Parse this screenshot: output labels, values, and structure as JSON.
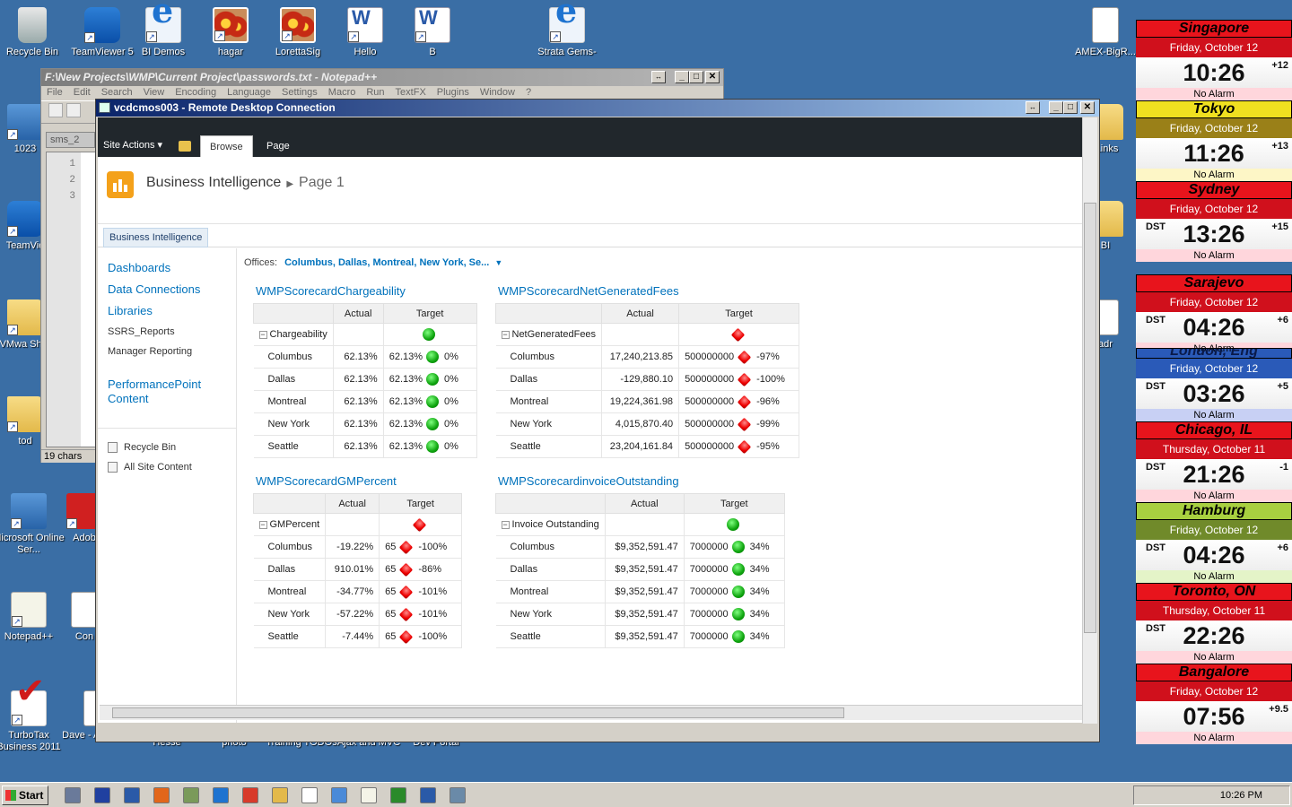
{
  "desktop_icons": [
    {
      "label": "Recycle Bin",
      "icon": "recycle-bin-icon"
    },
    {
      "label": "TeamViewer 5",
      "icon": "teamviewer-icon"
    },
    {
      "label": "BI Demos",
      "icon": "ie-icon"
    },
    {
      "label": "hagar",
      "icon": "flower-image-icon"
    },
    {
      "label": "LorettaSig",
      "icon": "flower-image-icon"
    },
    {
      "label": "Hello",
      "icon": "word-doc-icon"
    },
    {
      "label": "B",
      "icon": "word-doc-icon"
    },
    {
      "label": "Strata Gems-",
      "icon": "ie-icon"
    },
    {
      "label": "AMEX-BigR...",
      "icon": "document-icon"
    },
    {
      "label": "1023",
      "icon": "app-icon"
    },
    {
      "label": "TeamVie",
      "icon": "teamviewer-icon"
    },
    {
      "label": "VMwa Shar",
      "icon": "folder-icon"
    },
    {
      "label": "tod",
      "icon": "folder-icon"
    },
    {
      "label": "Microsoft Online Ser...",
      "icon": "ms-online-icon"
    },
    {
      "label": "Adob",
      "icon": "adobe-icon"
    },
    {
      "label": "Notepad++",
      "icon": "notepadpp-icon"
    },
    {
      "label": "Con",
      "icon": "document-icon"
    },
    {
      "label": "TurboTax Business 2011",
      "icon": "turbotax-icon"
    },
    {
      "label": "Dave - Australia",
      "icon": "document-icon"
    },
    {
      "label": ".Links",
      "icon": "folder-icon"
    },
    {
      "label": "BI",
      "icon": "folder-icon"
    },
    {
      "label": "adr",
      "icon": "document-icon"
    }
  ],
  "desktop_bottom_partial": [
    "Hesse",
    "photo",
    "Training TODOs",
    "Ajax and MVC",
    "Dev Portal"
  ],
  "notepad": {
    "title": "F:\\New Projects\\WMP\\Current Project\\passwords.txt - Notepad++",
    "menu": [
      "File",
      "Edit",
      "Search",
      "View",
      "Encoding",
      "Language",
      "Settings",
      "Macro",
      "Run",
      "TextFX",
      "Plugins",
      "Window",
      "?"
    ],
    "tab": "sms_2",
    "lines": [
      "1",
      "2",
      "3"
    ],
    "status": "19 chars",
    "status2": "2",
    "close_x": "X"
  },
  "rdp": {
    "title": "vcdcmos003 - Remote Desktop Connection"
  },
  "sharepoint": {
    "site_actions": "Site Actions",
    "tabs": [
      "Browse",
      "Page"
    ],
    "site_title": "Business Intelligence",
    "page_title": "Page 1",
    "top_nav": "Business Intelligence",
    "quick_launch": [
      "Dashboards",
      "Data Connections",
      "Libraries"
    ],
    "quick_launch_small": [
      "SSRS_Reports",
      "Manager Reporting"
    ],
    "performancepoint": "PerformancePoint Content",
    "recycle_bin": "Recycle Bin",
    "all_site_content": "All Site Content",
    "filter_label": "Offices:",
    "filter_value": "Columbus, Dallas, Montreal, New York, Se...",
    "scorecards": [
      {
        "title": "WMPScorecardChargeability",
        "headers": [
          "Actual",
          "Target"
        ],
        "group": {
          "label": "Chargeability",
          "indicator": "green-circle"
        },
        "rows": [
          {
            "name": "Columbus",
            "actual": "62.13%",
            "target": "62.13%",
            "indicator": "green-circle",
            "variance": "0%"
          },
          {
            "name": "Dallas",
            "actual": "62.13%",
            "target": "62.13%",
            "indicator": "green-circle",
            "variance": "0%"
          },
          {
            "name": "Montreal",
            "actual": "62.13%",
            "target": "62.13%",
            "indicator": "green-circle",
            "variance": "0%"
          },
          {
            "name": "New York",
            "actual": "62.13%",
            "target": "62.13%",
            "indicator": "green-circle",
            "variance": "0%"
          },
          {
            "name": "Seattle",
            "actual": "62.13%",
            "target": "62.13%",
            "indicator": "green-circle",
            "variance": "0%"
          }
        ]
      },
      {
        "title": "WMPScorecardNetGeneratedFees",
        "headers": [
          "Actual",
          "Target"
        ],
        "group": {
          "label": "NetGeneratedFees",
          "indicator": "red-diamond"
        },
        "rows": [
          {
            "name": "Columbus",
            "actual": "17,240,213.85",
            "target": "500000000",
            "indicator": "red-diamond",
            "variance": "-97%"
          },
          {
            "name": "Dallas",
            "actual": "-129,880.10",
            "target": "500000000",
            "indicator": "red-diamond",
            "variance": "-100%"
          },
          {
            "name": "Montreal",
            "actual": "19,224,361.98",
            "target": "500000000",
            "indicator": "red-diamond",
            "variance": "-96%"
          },
          {
            "name": "New York",
            "actual": "4,015,870.40",
            "target": "500000000",
            "indicator": "red-diamond",
            "variance": "-99%"
          },
          {
            "name": "Seattle",
            "actual": "23,204,161.84",
            "target": "500000000",
            "indicator": "red-diamond",
            "variance": "-95%"
          }
        ]
      },
      {
        "title": "WMPScorecardGMPercent",
        "headers": [
          "Actual",
          "Target"
        ],
        "group": {
          "label": "GMPercent",
          "indicator": "red-diamond"
        },
        "rows": [
          {
            "name": "Columbus",
            "actual": "-19.22%",
            "target": "65",
            "indicator": "red-diamond",
            "variance": "-100%"
          },
          {
            "name": "Dallas",
            "actual": "910.01%",
            "target": "65",
            "indicator": "red-diamond",
            "variance": "-86%"
          },
          {
            "name": "Montreal",
            "actual": "-34.77%",
            "target": "65",
            "indicator": "red-diamond",
            "variance": "-101%"
          },
          {
            "name": "New York",
            "actual": "-57.22%",
            "target": "65",
            "indicator": "red-diamond",
            "variance": "-101%"
          },
          {
            "name": "Seattle",
            "actual": "-7.44%",
            "target": "65",
            "indicator": "red-diamond",
            "variance": "-100%"
          }
        ]
      },
      {
        "title": "WMPScorecardinvoiceOutstanding",
        "headers": [
          "Actual",
          "Target"
        ],
        "group": {
          "label": "Invoice Outstanding",
          "indicator": "green-circle"
        },
        "rows": [
          {
            "name": "Columbus",
            "actual": "$9,352,591.47",
            "target": "7000000",
            "indicator": "green-circle",
            "variance": "34%"
          },
          {
            "name": "Dallas",
            "actual": "$9,352,591.47",
            "target": "7000000",
            "indicator": "green-circle",
            "variance": "34%"
          },
          {
            "name": "Montreal",
            "actual": "$9,352,591.47",
            "target": "7000000",
            "indicator": "green-circle",
            "variance": "34%"
          },
          {
            "name": "New York",
            "actual": "$9,352,591.47",
            "target": "7000000",
            "indicator": "green-circle",
            "variance": "34%"
          },
          {
            "name": "Seattle",
            "actual": "$9,352,591.47",
            "target": "7000000",
            "indicator": "green-circle",
            "variance": "34%"
          }
        ]
      }
    ]
  },
  "clocks": [
    {
      "city": "Singapore",
      "date": "Friday, October 12",
      "time": "10:26",
      "dst": "",
      "offset": "+12",
      "alarm": "No Alarm",
      "city_bg": "#e8141c",
      "date_bg": "#d0101c",
      "alarm_bg": "#ffd6dc"
    },
    {
      "city": "Tokyo",
      "date": "Friday, October 12",
      "time": "11:26",
      "dst": "",
      "offset": "+13",
      "alarm": "No Alarm",
      "city_bg": "#f0e020",
      "date_bg": "#9a8018",
      "alarm_bg": "#fdf6c6"
    },
    {
      "city": "Sydney",
      "date": "Friday, October 12",
      "time": "13:26",
      "dst": "DST",
      "offset": "+15",
      "alarm": "No Alarm",
      "city_bg": "#e8141c",
      "date_bg": "#d0101c",
      "alarm_bg": "#ffd6dc"
    },
    {
      "city": "Sarajevo",
      "date": "Friday, October 12",
      "time": "04:26",
      "dst": "DST",
      "offset": "+6",
      "alarm": "No Alarm",
      "city_bg": "#e8141c",
      "date_bg": "#d0101c",
      "alarm_bg": "#ffd6dc"
    },
    {
      "city": "London, Eng",
      "date": "Friday, October 12",
      "time": "03:26",
      "dst": "DST",
      "offset": "+5",
      "alarm": "No Alarm",
      "city_bg": "#2a5ab8",
      "date_bg": "#2a5ab8",
      "alarm_bg": "#c8d0f4"
    },
    {
      "city": "Chicago, IL",
      "date": "Thursday, October 11",
      "time": "21:26",
      "dst": "DST",
      "offset": "-1",
      "alarm": "No Alarm",
      "city_bg": "#e8141c",
      "date_bg": "#d0101c",
      "alarm_bg": "#ffd6dc"
    },
    {
      "city": "Hamburg",
      "date": "Friday, October 12",
      "time": "04:26",
      "dst": "DST",
      "offset": "+6",
      "alarm": "No Alarm",
      "city_bg": "#a8d040",
      "date_bg": "#708a2a",
      "alarm_bg": "#e4f4c8"
    },
    {
      "city": "Toronto, ON",
      "date": "Thursday, October 11",
      "time": "22:26",
      "dst": "DST",
      "offset": "",
      "alarm": "No Alarm",
      "city_bg": "#e8141c",
      "date_bg": "#d0101c",
      "alarm_bg": "#ffd6dc"
    },
    {
      "city": "Bangalore",
      "date": "Friday, October 12",
      "time": "07:56",
      "dst": "",
      "offset": "+9.5",
      "alarm": "No Alarm",
      "city_bg": "#e8141c",
      "date_bg": "#d0101c",
      "alarm_bg": "#ffd6dc"
    }
  ],
  "taskbar": {
    "start": "Start",
    "clock": "10:26 PM"
  }
}
